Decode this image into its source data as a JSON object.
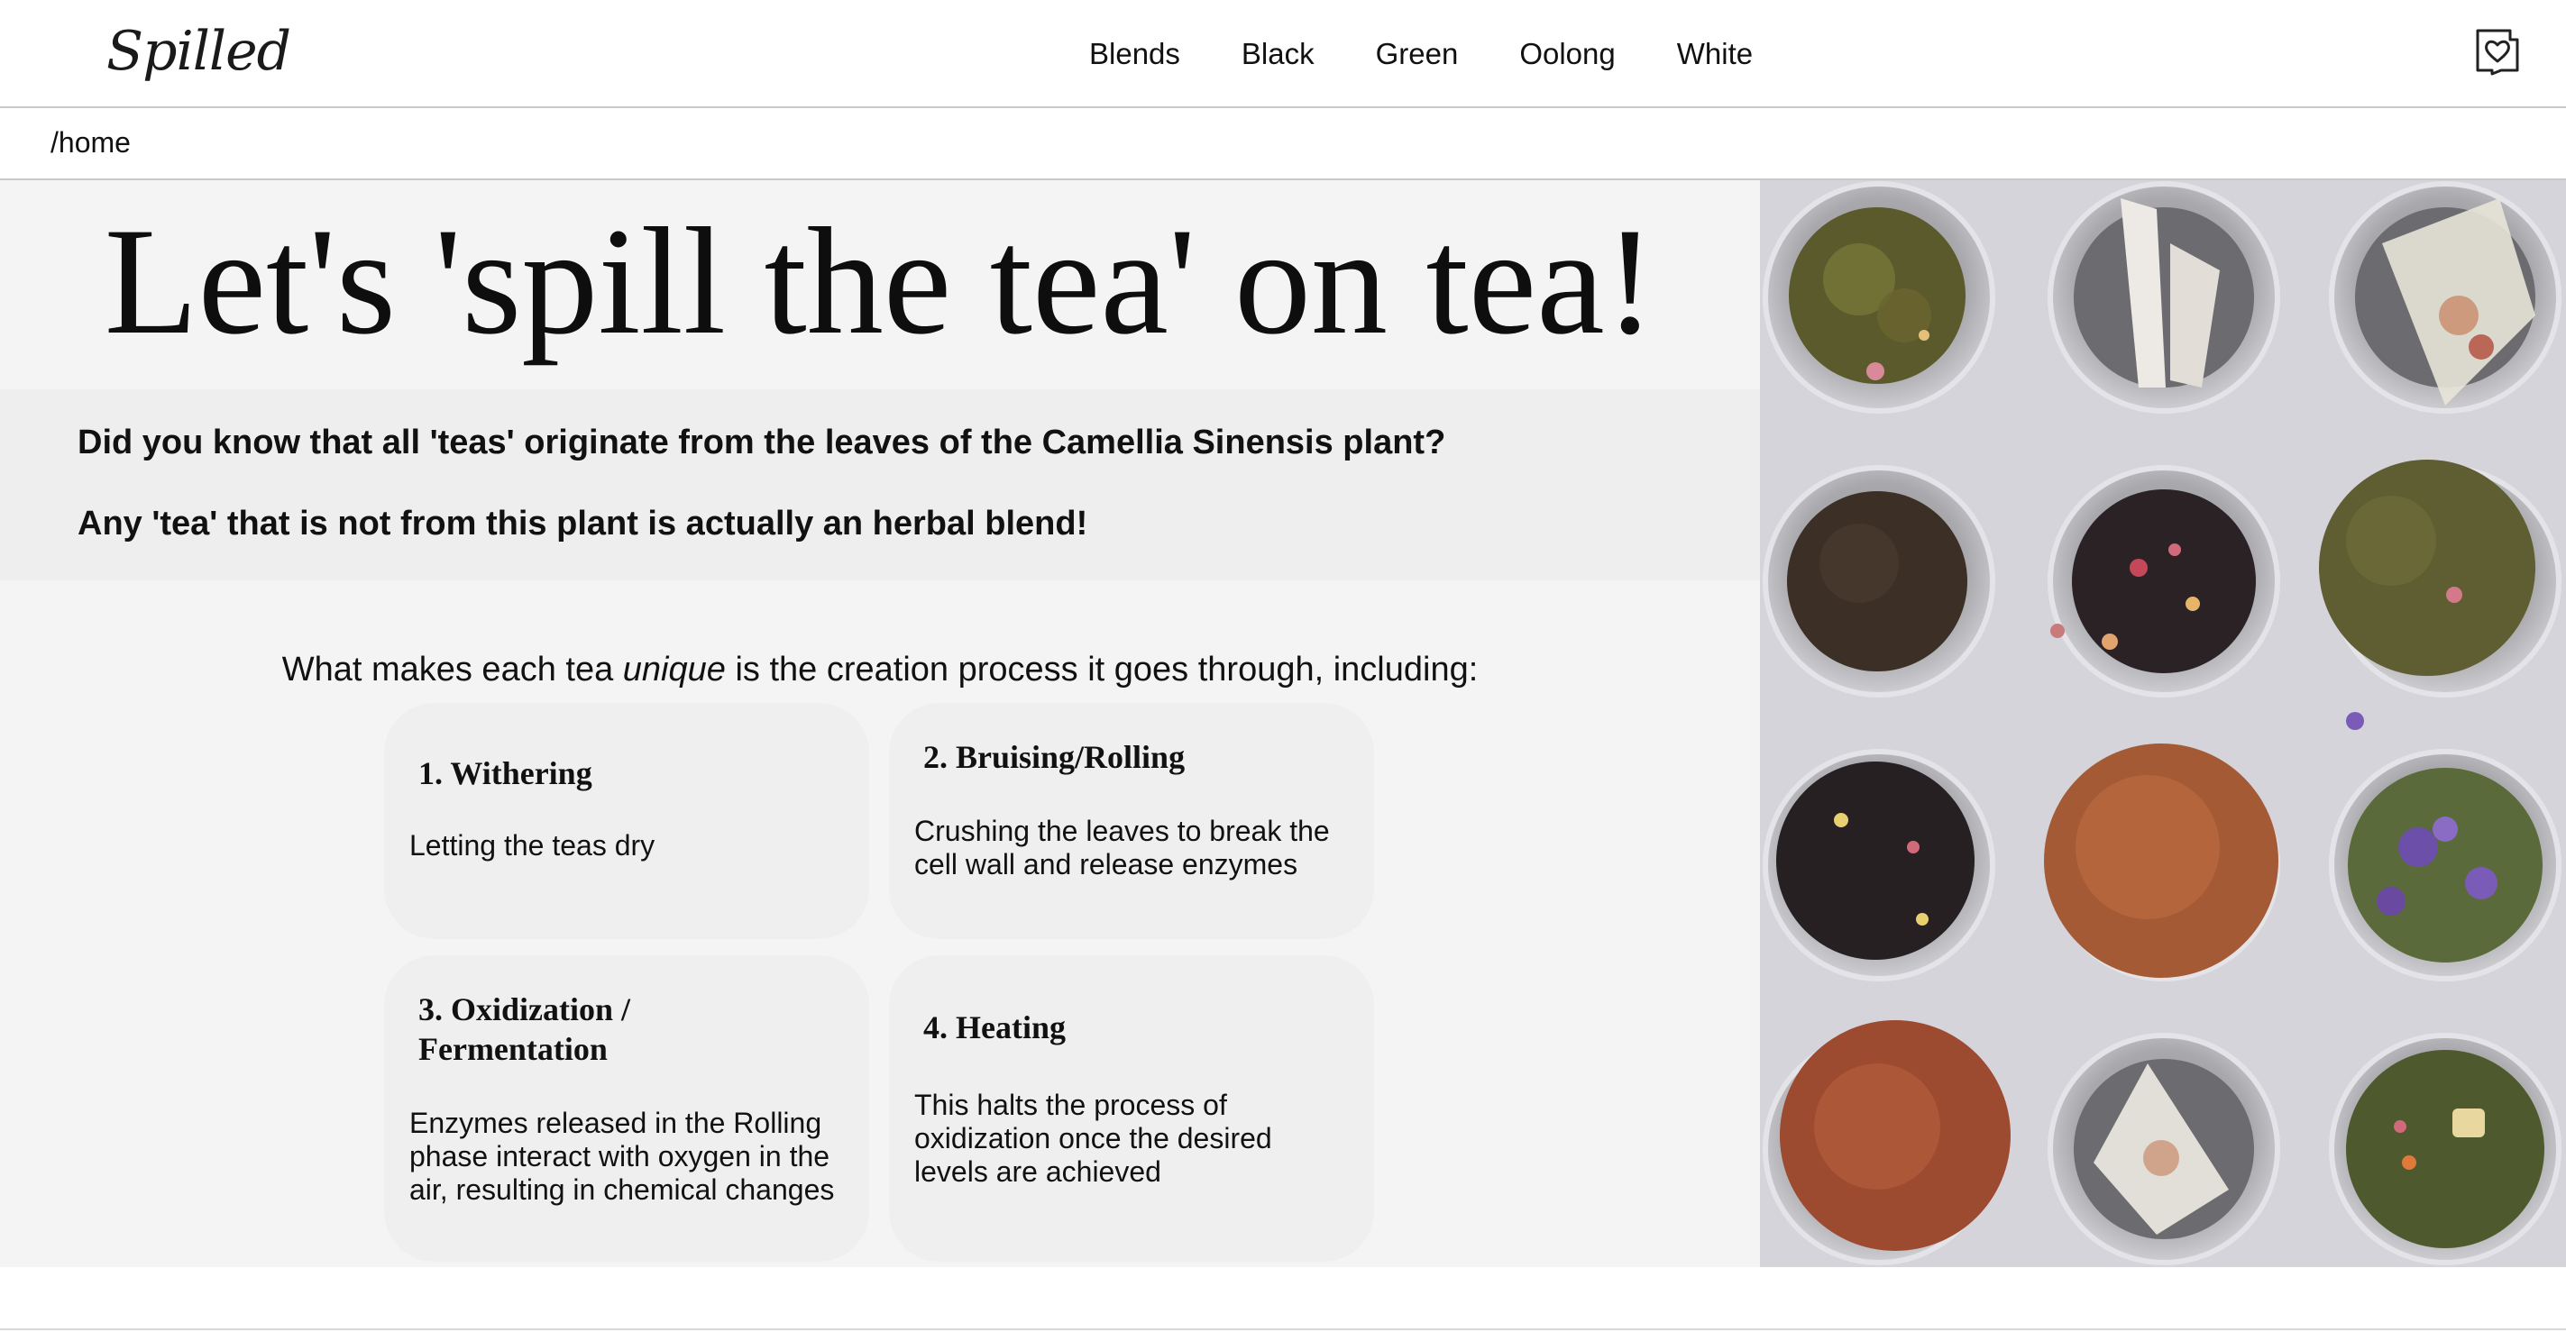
{
  "brand": {
    "logo_text": "Spilled"
  },
  "nav": {
    "items": [
      {
        "label": "Blends"
      },
      {
        "label": "Black"
      },
      {
        "label": "Green"
      },
      {
        "label": "Oolong"
      },
      {
        "label": "White"
      }
    ],
    "cart_icon": "shopping-bag-heart-icon"
  },
  "breadcrumb": {
    "path": "/home"
  },
  "hero": {
    "title": "Let's 'spill the tea' on tea!"
  },
  "facts": {
    "line1": "Did you know that all 'teas' originate from the leaves of the Camellia Sinensis plant?",
    "line2": "Any 'tea' that is not from this plant is actually an herbal blend!"
  },
  "process": {
    "intro_before": "What makes each tea ",
    "intro_emphasis": "unique",
    "intro_after": " is the creation process it goes through, including:",
    "steps": [
      {
        "title": "1. Withering",
        "body": "Letting the teas dry"
      },
      {
        "title": "2. Bruising/Rolling",
        "body": "Crushing the leaves to break the cell wall and release enzymes"
      },
      {
        "title": "3. Oxidization / Fermentation",
        "body": "Enzymes released in the Rolling phase interact with oxygen in the air, resulting in chemical changes"
      },
      {
        "title": "4. Heating",
        "body": "This halts the process of oxidization once the desired levels are achieved"
      }
    ]
  },
  "photo": {
    "subject": "loose-leaf-tea-tins-photo"
  },
  "colors": {
    "page_bg": "#f4f4f4",
    "band_bg": "#eeeeee",
    "card_bg": "#efefef",
    "divider": "#c9c9c9",
    "photo_bg": "#d3d3d9"
  }
}
